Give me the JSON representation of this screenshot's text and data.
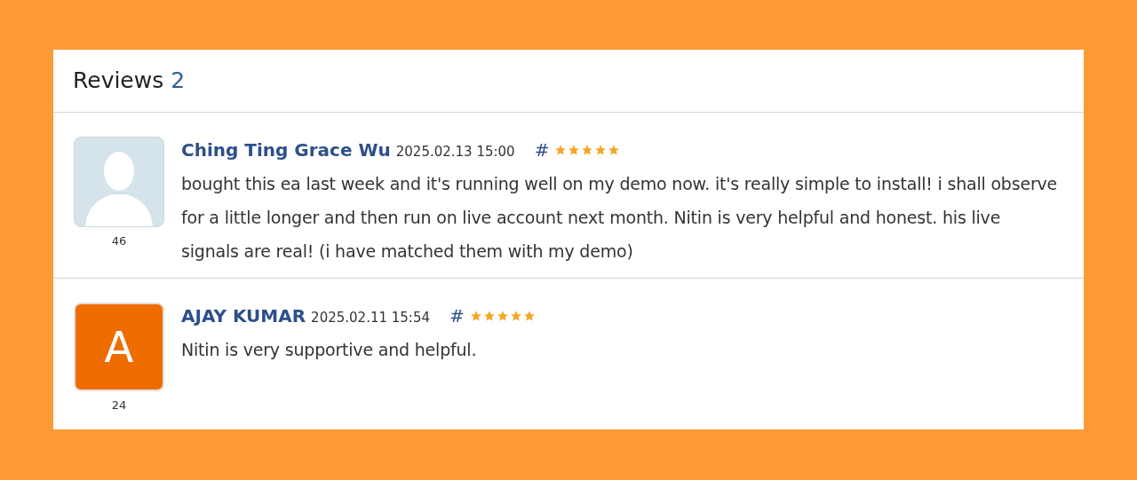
{
  "header": {
    "title": "Reviews",
    "count": "2"
  },
  "reviews": [
    {
      "author": "Ching Ting Grace Wu",
      "date": "2025.02.13 15:00",
      "anchor": "#",
      "stars": 5,
      "avatar": {
        "kind": "silhouette"
      },
      "user_count": "46",
      "text": "bought this ea last week and it's running well on my demo now. it's really simple to install! i shall observe for a little longer and then run on live account next month. Nitin is very helpful and honest. his live signals are real! (i have matched them with my demo)"
    },
    {
      "author": "AJAY KUMAR",
      "date": "2025.02.11 15:54",
      "anchor": "#",
      "stars": 5,
      "avatar": {
        "kind": "letter",
        "letter": "A",
        "color": "#ef6c00"
      },
      "user_count": "24",
      "text": "Nitin is very supportive and helpful."
    }
  ]
}
